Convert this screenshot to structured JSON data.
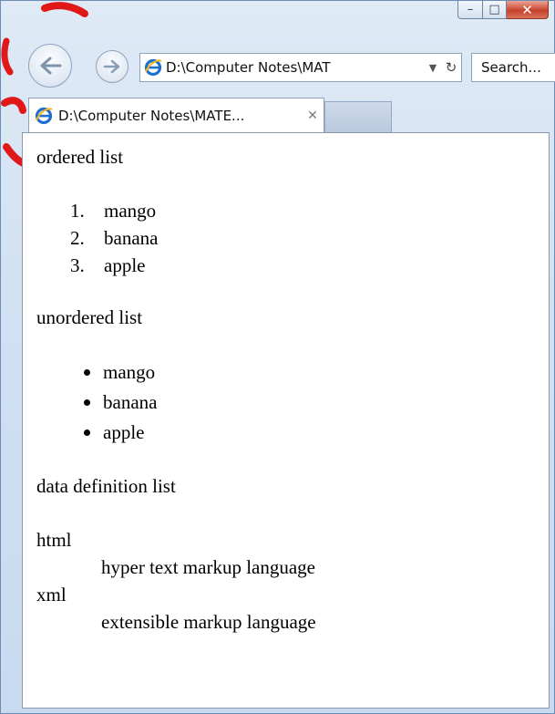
{
  "window": {
    "minimize_glyph": "–",
    "maximize_glyph": "□",
    "close_glyph": "✕"
  },
  "toolbar": {
    "back_icon": "back-arrow-icon",
    "forward_icon": "forward-arrow-icon",
    "address_value": "D:\\Computer Notes\\MAT",
    "dropdown_glyph": "▼",
    "refresh_glyph": "↻",
    "search_placeholder": "Search..."
  },
  "tab": {
    "title": "D:\\Computer Notes\\MATE...",
    "close_glyph": "✕"
  },
  "content": {
    "ordered_heading": "ordered list",
    "ordered_items": [
      {
        "num": "1.",
        "text": "mango"
      },
      {
        "num": "2.",
        "text": "banana"
      },
      {
        "num": "3.",
        "text": "apple"
      }
    ],
    "unordered_heading": "unordered list",
    "unordered_items": [
      "mango",
      "banana",
      "apple"
    ],
    "definition_heading": "data definition list",
    "definitions": [
      {
        "term": "html",
        "desc": "hyper text markup language"
      },
      {
        "term": "xml",
        "desc": "extensible markup language"
      }
    ]
  },
  "colors": {
    "frame": "#d2e1f2",
    "close_button": "#c4402a",
    "annotation_red": "#e01818"
  }
}
